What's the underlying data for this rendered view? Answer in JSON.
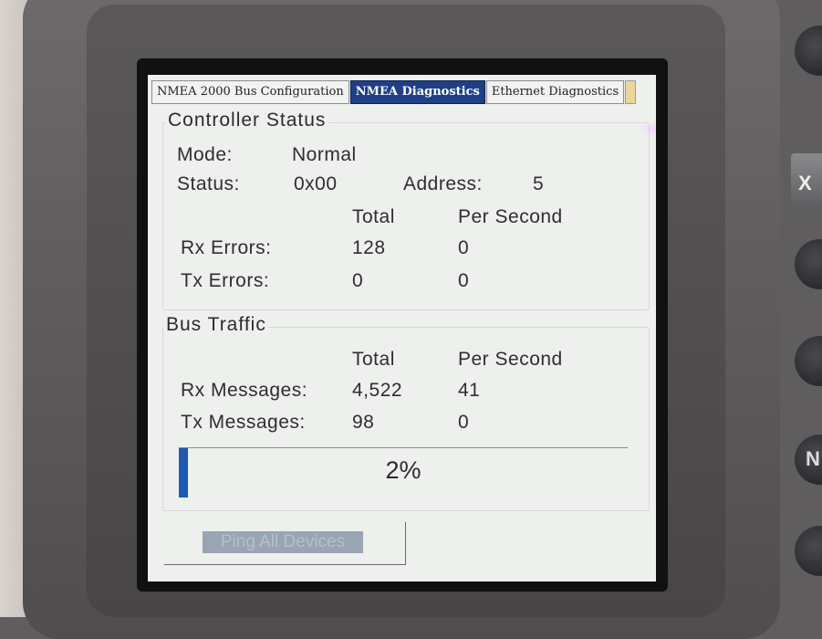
{
  "tabs": [
    {
      "label": "NMEA 2000 Bus Configuration",
      "active": false
    },
    {
      "label": "NMEA Diagnostics",
      "active": true
    },
    {
      "label": "Ethernet Diagnostics",
      "active": false
    }
  ],
  "controller_status": {
    "title": "Controller Status",
    "mode_label": "Mode:",
    "mode_value": "Normal",
    "status_label": "Status:",
    "status_value": "0x00",
    "address_label": "Address:",
    "address_value": "5",
    "col_total": "Total",
    "col_per_second": "Per Second",
    "rows": [
      {
        "label": "Rx Errors:",
        "total": "128",
        "per_second": "0"
      },
      {
        "label": "Tx Errors:",
        "total": "0",
        "per_second": "0"
      }
    ]
  },
  "bus_traffic": {
    "title": "Bus Traffic",
    "col_total": "Total",
    "col_per_second": "Per Second",
    "rows": [
      {
        "label": "Rx Messages:",
        "total": "4,522",
        "per_second": "41"
      },
      {
        "label": "Tx Messages:",
        "total": "98",
        "per_second": "0"
      }
    ],
    "load_text": "2%",
    "load_fraction": 0.02
  },
  "ping_button_label": "Ping All Devices",
  "colors": {
    "active_tab": "#1f3f86",
    "progress_fill": "#1e58b0",
    "screen_bg": "#eef0ee"
  },
  "side_buttons": [
    "X",
    "N"
  ]
}
